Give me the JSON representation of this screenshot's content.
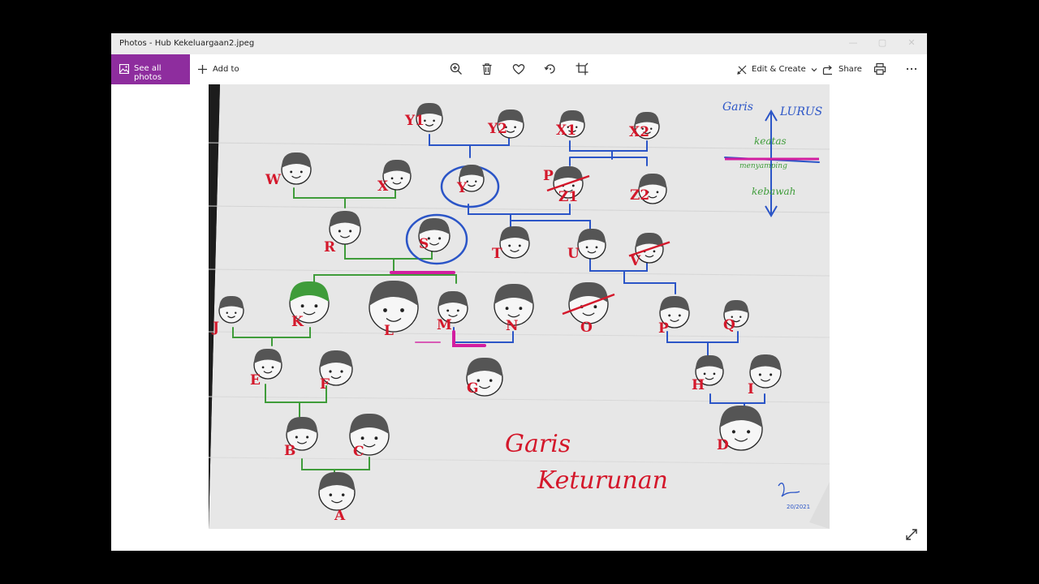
{
  "window": {
    "title": "Photos - Hub Kekeluargaan2.jpeg"
  },
  "toolbar": {
    "see_all_label": "See all photos",
    "add_to_label": "Add to",
    "edit_create_label": "Edit & Create",
    "share_label": "Share"
  },
  "icons": {
    "photos": "photos-icon",
    "add": "plus-icon",
    "zoom": "zoom-in-icon",
    "delete": "trash-icon",
    "favorite": "heart-icon",
    "rotate": "rotate-icon",
    "crop": "crop-icon",
    "edit": "edit-create-icon",
    "share": "share-icon",
    "print": "print-icon",
    "more": "more-icon",
    "fullscreen": "expand-icon"
  },
  "photo": {
    "legend": {
      "title_left": "Garis",
      "title_right": "LURUS",
      "up": "keatas",
      "side": "menyamping",
      "down": "kebawah"
    },
    "caption_line1": "Garis",
    "caption_line2": "Keturunan",
    "signature": "20/2021",
    "people": [
      {
        "id": "y1",
        "label": "Y1"
      },
      {
        "id": "y2",
        "label": "Y2"
      },
      {
        "id": "x1",
        "label": "X1"
      },
      {
        "id": "x2",
        "label": "X2"
      },
      {
        "id": "w",
        "label": "W"
      },
      {
        "id": "x",
        "label": "X"
      },
      {
        "id": "y",
        "label": "Y"
      },
      {
        "id": "p-top",
        "label": "P"
      },
      {
        "id": "z1",
        "label": "Z1"
      },
      {
        "id": "z2",
        "label": "Z2"
      },
      {
        "id": "r",
        "label": "R"
      },
      {
        "id": "s",
        "label": "S"
      },
      {
        "id": "t",
        "label": "T"
      },
      {
        "id": "u",
        "label": "U"
      },
      {
        "id": "v",
        "label": "V"
      },
      {
        "id": "j",
        "label": "J"
      },
      {
        "id": "k",
        "label": "K"
      },
      {
        "id": "l",
        "label": "L"
      },
      {
        "id": "m",
        "label": "M"
      },
      {
        "id": "n",
        "label": "N"
      },
      {
        "id": "o",
        "label": "O"
      },
      {
        "id": "p",
        "label": "P"
      },
      {
        "id": "q",
        "label": "Q"
      },
      {
        "id": "e",
        "label": "E"
      },
      {
        "id": "f",
        "label": "F"
      },
      {
        "id": "g",
        "label": "G"
      },
      {
        "id": "h",
        "label": "H"
      },
      {
        "id": "i",
        "label": "I"
      },
      {
        "id": "b",
        "label": "B"
      },
      {
        "id": "c",
        "label": "C"
      },
      {
        "id": "d",
        "label": "D"
      },
      {
        "id": "a",
        "label": "A"
      }
    ]
  },
  "colors": {
    "accent": "#8e2d9e",
    "red_ink": "#d4182b",
    "green_ink": "#3f9c3a",
    "blue_ink": "#2b55c7",
    "magenta_ink": "#d21ea0"
  }
}
